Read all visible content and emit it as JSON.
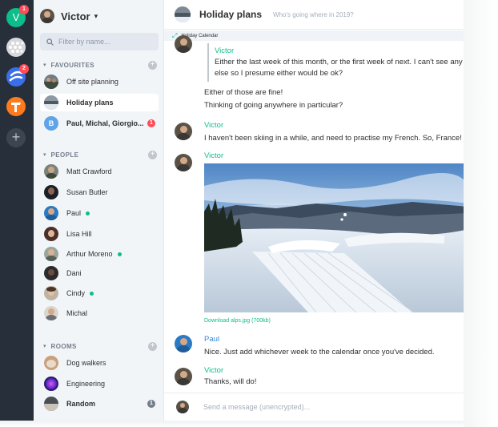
{
  "spaces": [
    {
      "name": "V",
      "badge": "1"
    },
    {
      "badge": "2"
    }
  ],
  "user": {
    "name": "Victor",
    "chevron": "▾"
  },
  "filter": {
    "placeholder": "Filter by name..."
  },
  "sections": {
    "favourites": {
      "label": "FAVOURITES",
      "chevron": "▾",
      "add": "+"
    },
    "people": {
      "label": "PEOPLE",
      "chevron": "▾",
      "add": "+"
    },
    "rooms": {
      "label": "ROOMS",
      "chevron": "▾",
      "add": "+"
    }
  },
  "favourites": [
    {
      "name": "Off site planning"
    },
    {
      "name": "Holiday plans",
      "active": true
    },
    {
      "name": "Paul, Michal, Giorgio...",
      "initial": "B",
      "badge": "1"
    }
  ],
  "people": [
    {
      "name": "Matt Crawford"
    },
    {
      "name": "Susan Butler"
    },
    {
      "name": "Paul",
      "online": true
    },
    {
      "name": "Lisa Hill"
    },
    {
      "name": "Arthur Moreno",
      "online": true
    },
    {
      "name": "Dani"
    },
    {
      "name": "Cindy",
      "online": true
    },
    {
      "name": "Michal"
    }
  ],
  "rooms": [
    {
      "name": "Dog walkers"
    },
    {
      "name": "Engineering"
    },
    {
      "name": "Random",
      "badge": "1"
    }
  ],
  "room": {
    "title": "Holiday plans",
    "topic": "Who's going where in 2019?",
    "widget": "Holiday Calendar"
  },
  "timeline": {
    "quote_sender": "Victor",
    "quote_line1": "Either the last week of this month, or the first week of next. I can't see any c",
    "quote_line2": "else so I presume either would be ok?",
    "reply1": "Either of those are fine!",
    "reply2": "Thinking of going anywhere in particular?",
    "msg1_sender": "Victor",
    "msg1_text": "I haven't been skiing in a while, and need to practise my French. So, France!",
    "msg2_sender": "Victor",
    "download": "Download alps.jpg (700kb)",
    "msg3_sender": "Paul",
    "msg3_text": "Nice. Just add whichever week to the calendar once you've decided.",
    "msg4_sender": "Victor",
    "msg4_text": "Thanks, will do!"
  },
  "composer": {
    "placeholder": "Send a message (unencrypted)..."
  },
  "colors": {
    "accent": "#0dbd8b",
    "badge_red": "#ff4b55",
    "badge_grey": "#737d8c",
    "sender_blue": "#368bd6"
  }
}
